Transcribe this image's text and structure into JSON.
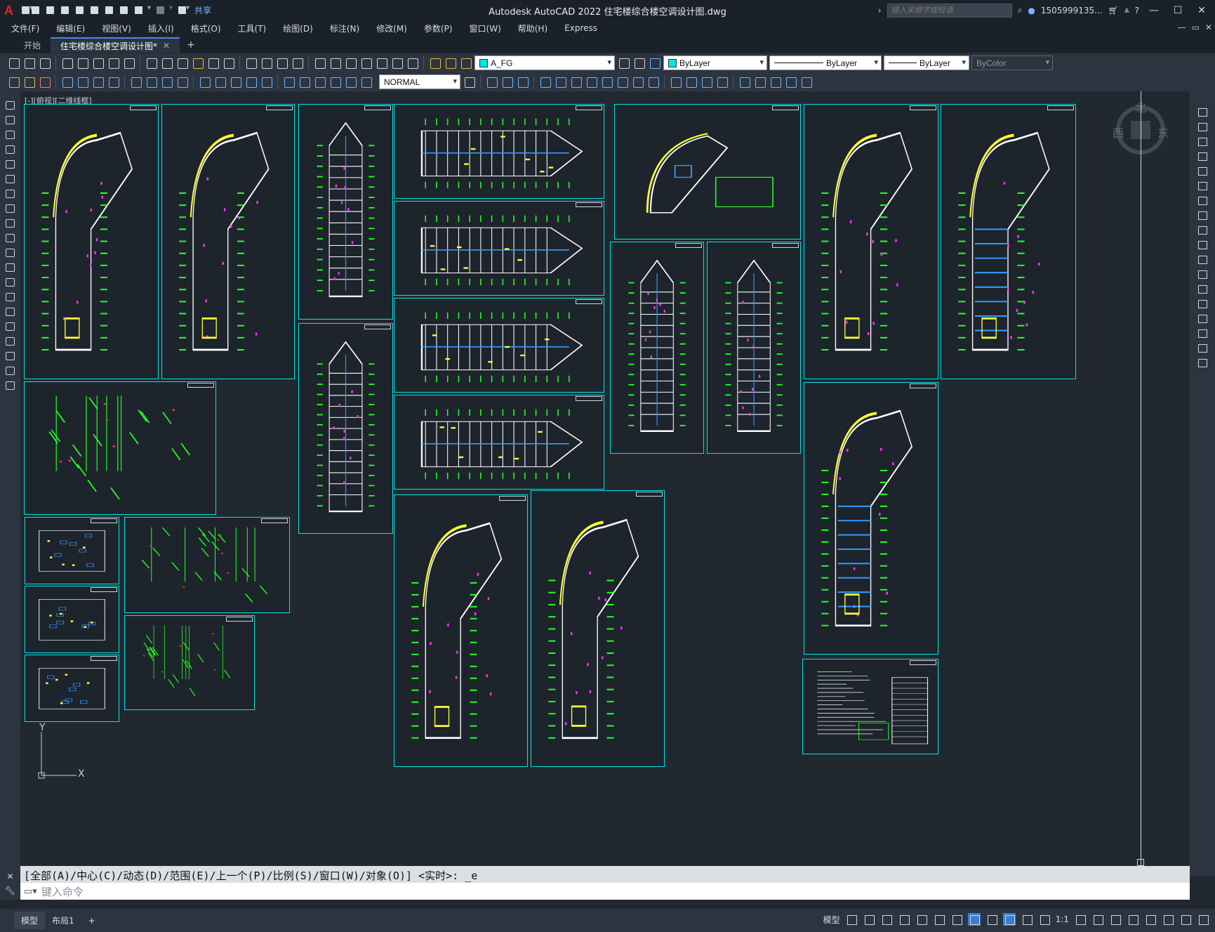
{
  "window": {
    "title": "Autodesk AutoCAD 2022    住宅楼综合楼空调设计图.dwg",
    "share_label": "共享",
    "search_placeholder": "键入关键字或短语",
    "user": "1505999135...",
    "controls": [
      "—",
      "☐",
      "✕"
    ]
  },
  "menu": {
    "items": [
      "文件(F)",
      "编辑(E)",
      "视图(V)",
      "插入(I)",
      "格式(O)",
      "工具(T)",
      "绘图(D)",
      "标注(N)",
      "修改(M)",
      "参数(P)",
      "窗口(W)",
      "帮助(H)",
      "Express"
    ],
    "doc_controls": [
      "—",
      "▭",
      "✕"
    ]
  },
  "tabs": {
    "start": "开始",
    "active": "住宅楼综合楼空调设计图*",
    "close": "✕",
    "add": "+"
  },
  "toolbar": {
    "layer": "A_FG",
    "color": "ByLayer",
    "linetype": "ByLayer",
    "lineweight": "ByLayer",
    "plotstyle": "ByColor",
    "dimstyle": "NORMAL",
    "layer_swatch": "#00e6e6",
    "color_swatch": "#00e6e6"
  },
  "viewport": {
    "label": "[-][俯视][二维线框]",
    "viewcube_north": "北",
    "viewcube_west": "西",
    "viewcube_east": "东",
    "ucs_x": "X",
    "ucs_y": "Y",
    "plan_colors": {
      "walls": "#ffffff",
      "grid": "#22ff22",
      "equipment": "#ff33ff",
      "curve": "#ffff33",
      "duct": "#3399ff",
      "frame": "#00e6e6"
    }
  },
  "command": {
    "history": "[全部(A)/中心(C)/动态(D)/范围(E)/上一个(P)/比例(S)/窗口(W)/对象(O)] <实时>: _e",
    "placeholder": "键入命令"
  },
  "status": {
    "model_tab": "模型",
    "layout_tab": "布局1",
    "add": "+",
    "model_button": "模型",
    "scale": "1:1"
  }
}
